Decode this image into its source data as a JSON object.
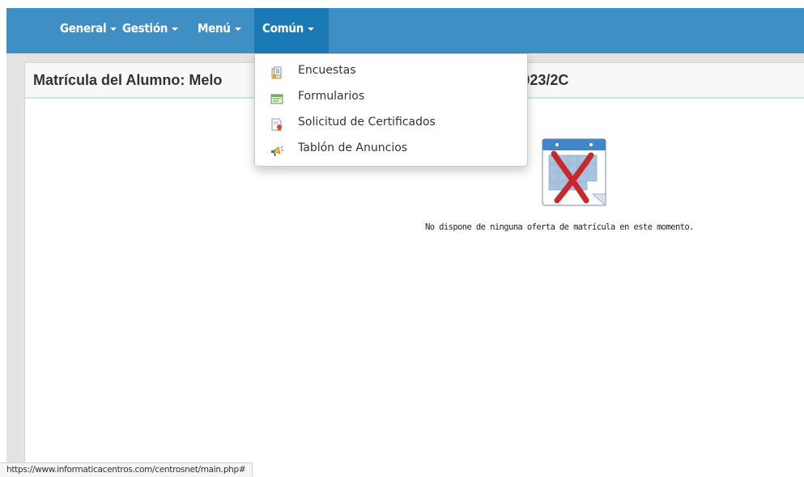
{
  "navbar": {
    "items": [
      {
        "label": "General",
        "active": false
      },
      {
        "label": "Gestión",
        "active": false
      },
      {
        "label": "Menú",
        "active": false
      },
      {
        "label": "Común",
        "active": true
      }
    ],
    "accent_color": "#3f8fc4",
    "active_color": "#1b79b6"
  },
  "panel": {
    "title": "Matrícula del Alumno: Melo",
    "title_suffix": "r: 2023/2C"
  },
  "main": {
    "empty_icon": "calendar-cancel-icon",
    "empty_message": "No dispone de ninguna oferta de matrícula en este momento."
  },
  "dropdown": {
    "items": [
      {
        "label": "Encuestas",
        "icon": "survey-icon"
      },
      {
        "label": "Formularios",
        "icon": "form-icon"
      },
      {
        "label": "Solicitud de Certificados",
        "icon": "certificate-icon"
      },
      {
        "label": "Tablón de Anuncios",
        "icon": "announcement-board-icon"
      }
    ]
  },
  "statusbar": {
    "url": "https://www.informaticacentros.com/centrosnet/main.php#"
  }
}
